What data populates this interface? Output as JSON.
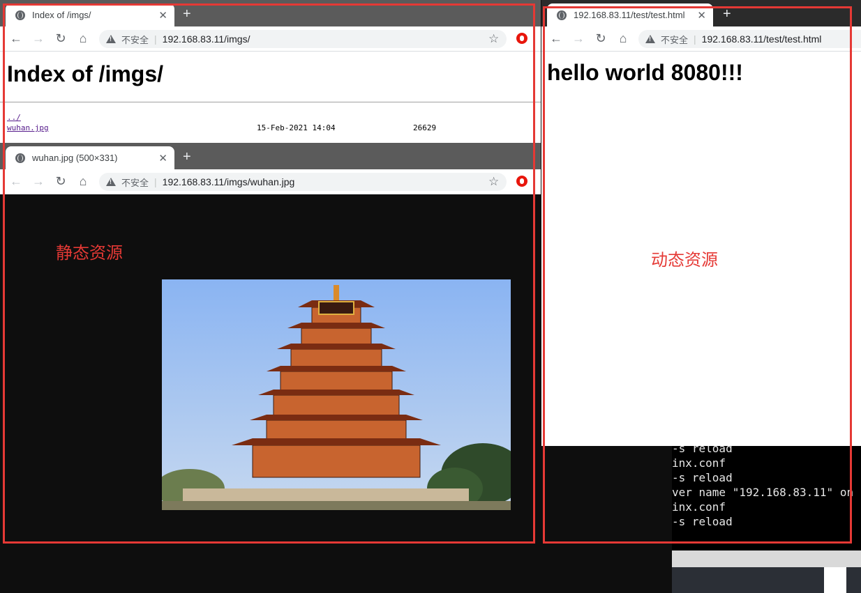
{
  "colors": {
    "annotation_red": "#e53935",
    "tab_bar_dark": "#2b2b2b",
    "tab_bar_gray": "#5b5b5b",
    "link_visited": "#551a8b"
  },
  "window_index": {
    "tab": {
      "title": "Index of /imgs/",
      "icon": "globe-icon",
      "close_icon": "close-icon"
    },
    "toolbar": {
      "security_label": "不安全",
      "url": "192.168.83.11/imgs/"
    },
    "page": {
      "heading": "Index of /imgs/",
      "rows": [
        {
          "name": "../",
          "date": "",
          "size": ""
        },
        {
          "name": "wuhan.jpg",
          "date": "15-Feb-2021 14:04",
          "size": "26629"
        }
      ]
    }
  },
  "window_image": {
    "tab": {
      "title": "wuhan.jpg (500×331)",
      "icon": "globe-icon",
      "close_icon": "close-icon"
    },
    "toolbar": {
      "security_label": "不安全",
      "url": "192.168.83.11/imgs/wuhan.jpg"
    },
    "image": {
      "subject": "Yellow Crane Tower photo",
      "icon": "pagoda-photo"
    }
  },
  "window_dynamic": {
    "tab": {
      "title": "192.168.83.11/test/test.html",
      "icon": "globe-icon",
      "close_icon": "close-icon"
    },
    "toolbar": {
      "security_label": "不安全",
      "url": "192.168.83.11/test/test.html"
    },
    "page": {
      "heading": "hello world 8080!!!"
    }
  },
  "terminal": {
    "lines": [
      "-s reload",
      "inx.conf",
      "-s reload",
      "ver name \"192.168.83.11\" on",
      "inx.conf",
      "-s reload"
    ]
  },
  "annotations": {
    "static_label": "静态资源",
    "dynamic_label": "动态资源"
  }
}
